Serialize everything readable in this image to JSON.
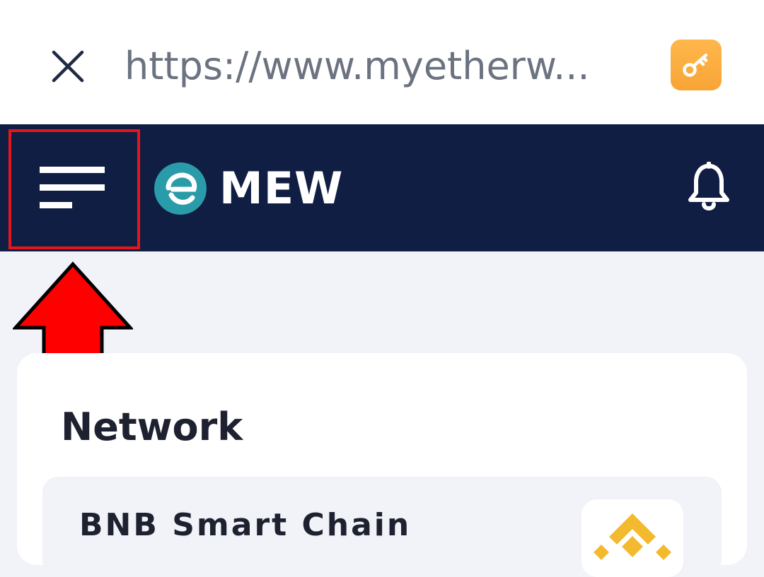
{
  "browser": {
    "url": "https://www.myetherw...",
    "close_icon": "close-icon",
    "key_icon": "key-icon",
    "key_button_color": "#f7a535"
  },
  "header": {
    "logo_text": "MEW",
    "menu_icon": "hamburger-menu-icon",
    "bell_icon": "bell-icon",
    "background_color": "#101e43",
    "logo_color": "#2a9ba8"
  },
  "annotation": {
    "highlight_color": "#e8161c",
    "arrow_icon": "red-arrow-up-icon"
  },
  "network_card": {
    "title": "Network",
    "selected_network": {
      "name": "BNB Smart Chain",
      "icon": "bnb-logo-icon",
      "icon_color": "#f3ba2f"
    }
  }
}
